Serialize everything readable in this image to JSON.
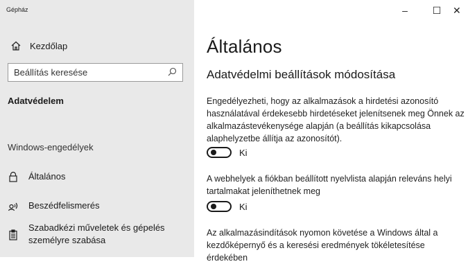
{
  "window": {
    "title": "Gépház",
    "minimize_label": "–",
    "maximize_label": "☐",
    "close_label": "✕"
  },
  "sidebar": {
    "home_label": "Kezdőlap",
    "search_placeholder": "Beállítás keresése",
    "section_label": "Adatvédelem",
    "group_header": "Windows-engedélyek",
    "items": [
      {
        "label": "Általános",
        "icon": "lock-icon"
      },
      {
        "label": "Beszédfelismerés",
        "icon": "speech-icon"
      },
      {
        "label": "Szabadkézi műveletek és gépelés személyre szabása",
        "icon": "clipboard-icon"
      }
    ]
  },
  "main": {
    "title": "Általános",
    "subtitle": "Adatvédelmi beállítások módosítása",
    "settings": [
      {
        "description": "Engedélyezheti, hogy az alkalmazások a hirdetési azonosító használatával érdekesebb hirdetéseket jelenítsenek meg Önnek az alkalmazástevékenysége alapján (a beállítás kikapcsolása alaphelyzetbe állítja az azonosítót).",
        "state_label": "Ki",
        "on": false
      },
      {
        "description": "A webhelyek a fiókban beállított nyelvlista alapján releváns helyi tartalmakat jeleníthetnek meg",
        "state_label": "Ki",
        "on": false
      },
      {
        "description": "Az alkalmazásindítások nyomon követése a Windows által a kezdőképernyő és a keresési eredmények tökéletesítése érdekében"
      }
    ]
  }
}
